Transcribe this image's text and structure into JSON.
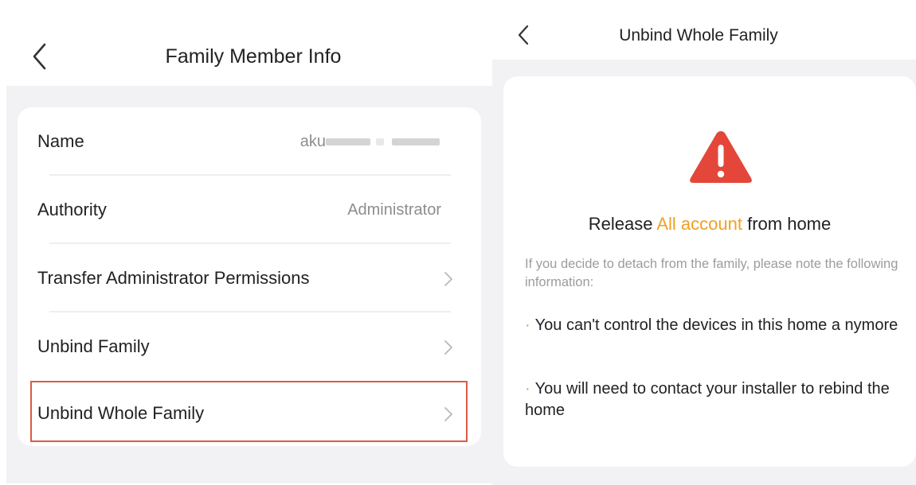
{
  "colors": {
    "accent": "#f0a020",
    "warning_red": "#e4473a",
    "highlight_border": "#dd5a45",
    "background_gray": "#f2f2f4"
  },
  "left": {
    "back_icon": "chevron-left-icon",
    "title": "Family Member Info",
    "rows": [
      {
        "label": "Name",
        "value": "aku",
        "value_masked": true
      },
      {
        "label": "Authority",
        "value": "Administrator"
      },
      {
        "label": "Transfer Administrator Permissions",
        "icon": "chevron-right-icon"
      },
      {
        "label": "Unbind Family",
        "icon": "chevron-right-icon"
      },
      {
        "label": "Unbind Whole Family",
        "icon": "chevron-right-icon",
        "highlighted": true
      }
    ]
  },
  "right": {
    "back_icon": "chevron-left-icon",
    "title": "Unbind Whole Family",
    "warning_icon": "warning-triangle-icon",
    "release": {
      "prefix": "Release ",
      "highlight": "All account",
      "suffix": " from home"
    },
    "note": "If you decide to detach from the family, please note the following information:",
    "bullets": [
      {
        "dot": "·",
        "text": "You can't control the devices in this home a nymore"
      },
      {
        "dot": "·",
        "text": "You will need to contact your installer to rebind the home"
      }
    ]
  }
}
